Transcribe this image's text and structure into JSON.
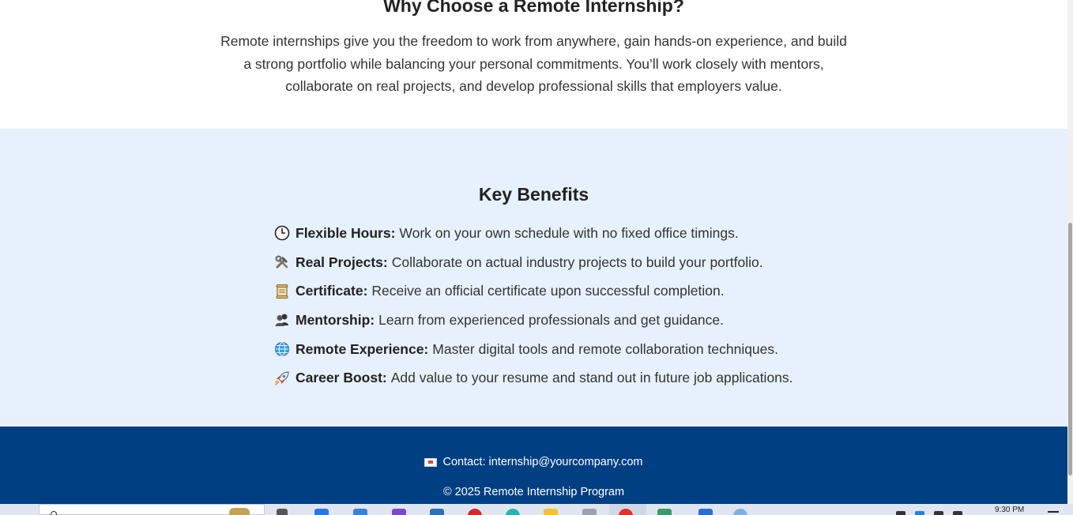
{
  "why_section": {
    "title": "Why Choose a Remote Internship?",
    "text": "Remote internships give you the freedom to work from anywhere, gain hands-on experience, and build a strong portfolio while balancing your personal commitments. You’ll work closely with mentors, collaborate on real projects, and develop professional skills that employers value."
  },
  "benefits": {
    "title": "Key Benefits",
    "items": [
      {
        "icon": "clock-icon",
        "name": "Flexible Hours:",
        "text": "Work on your own schedule with no fixed office timings."
      },
      {
        "icon": "tools-icon",
        "name": "Real Projects:",
        "text": "Collaborate on actual industry projects to build your portfolio."
      },
      {
        "icon": "scroll-icon",
        "name": "Certificate:",
        "text": "Receive an official certificate upon successful completion."
      },
      {
        "icon": "people-icon",
        "name": "Mentorship:",
        "text": "Learn from experienced professionals and get guidance."
      },
      {
        "icon": "globe-icon",
        "name": "Remote Experience:",
        "text": "Master digital tools and remote collaboration techniques."
      },
      {
        "icon": "rocket-icon",
        "name": "Career Boost:",
        "text": "Add value to your resume and stand out in future job applications."
      }
    ]
  },
  "footer": {
    "contact": "Contact: internship@yourcompany.com",
    "copyright": "© 2025 Remote Internship Program"
  },
  "taskbar": {
    "clock": "9:30 PM"
  },
  "colors": {
    "footer_bg": "#003f82",
    "benefits_bg": "#e6f1fd"
  }
}
